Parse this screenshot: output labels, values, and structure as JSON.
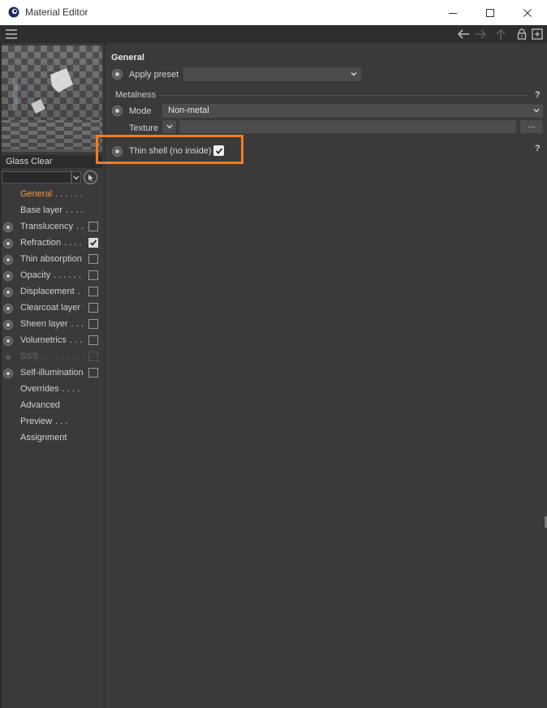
{
  "window": {
    "title": "Material Editor",
    "controls": [
      "minimize",
      "maximize",
      "close"
    ]
  },
  "toolbar": {
    "icons": [
      "menu-icon",
      "back-arrow-icon",
      "forward-arrow-icon",
      "up-arrow-icon",
      "lock-icon",
      "new-window-icon"
    ]
  },
  "material": {
    "name": "Glass Clear",
    "filter_value": ""
  },
  "nav": [
    {
      "label": "General",
      "dots": ". . . . . .",
      "radio": false,
      "checkbox": null,
      "active": true,
      "dim": false
    },
    {
      "label": "Base layer",
      "dots": ". . . .",
      "radio": false,
      "checkbox": null,
      "active": false,
      "dim": false
    },
    {
      "label": "Translucency",
      "dots": ". .",
      "radio": true,
      "checkbox": false,
      "active": false,
      "dim": false
    },
    {
      "label": "Refraction",
      "dots": ". . . .",
      "radio": true,
      "checkbox": true,
      "active": false,
      "dim": false
    },
    {
      "label": "Thin absorption",
      "dots": "",
      "radio": true,
      "checkbox": false,
      "active": false,
      "dim": false
    },
    {
      "label": "Opacity",
      "dots": ". . . . . .",
      "radio": true,
      "checkbox": false,
      "active": false,
      "dim": false
    },
    {
      "label": "Displacement",
      "dots": ".",
      "radio": true,
      "checkbox": false,
      "active": false,
      "dim": false
    },
    {
      "label": "Clearcoat layer",
      "dots": "",
      "radio": true,
      "checkbox": false,
      "active": false,
      "dim": false
    },
    {
      "label": "Sheen layer",
      "dots": ". . .",
      "radio": true,
      "checkbox": false,
      "active": false,
      "dim": false
    },
    {
      "label": "Volumetrics",
      "dots": ". . .",
      "radio": true,
      "checkbox": false,
      "active": false,
      "dim": false
    },
    {
      "label": "SSS",
      "dots": ". . . . . . . .",
      "radio": "small",
      "checkbox": false,
      "active": false,
      "dim": true
    },
    {
      "label": "Self-illumination",
      "dots": "",
      "radio": true,
      "checkbox": false,
      "active": false,
      "dim": false
    },
    {
      "label": "Overrides",
      "dots": ". . . .",
      "radio": false,
      "checkbox": null,
      "active": false,
      "dim": false
    },
    {
      "label": "Advanced",
      "dots": "",
      "radio": false,
      "checkbox": null,
      "active": false,
      "dim": false
    },
    {
      "label": "Preview",
      "dots": ". . .",
      "radio": false,
      "checkbox": null,
      "active": false,
      "dim": false
    },
    {
      "label": "Assignment",
      "dots": "",
      "radio": false,
      "checkbox": null,
      "active": false,
      "dim": false
    }
  ],
  "general": {
    "title": "General",
    "apply_preset_label": "Apply preset",
    "apply_preset_value": "",
    "metalness_group": "Metalness",
    "help": "?",
    "mode_label": "Mode",
    "mode_value": "Non-metal",
    "texture_label": "Texture",
    "texture_value": "",
    "dots_button": "...",
    "thin_shell_label": "Thin shell (no inside)",
    "thin_shell_checked": true
  },
  "colors": {
    "accent": "#f39b3a",
    "highlight": "#f47b22",
    "panel_bg": "#3a3a3a",
    "field_bg": "#4c4c4c"
  }
}
